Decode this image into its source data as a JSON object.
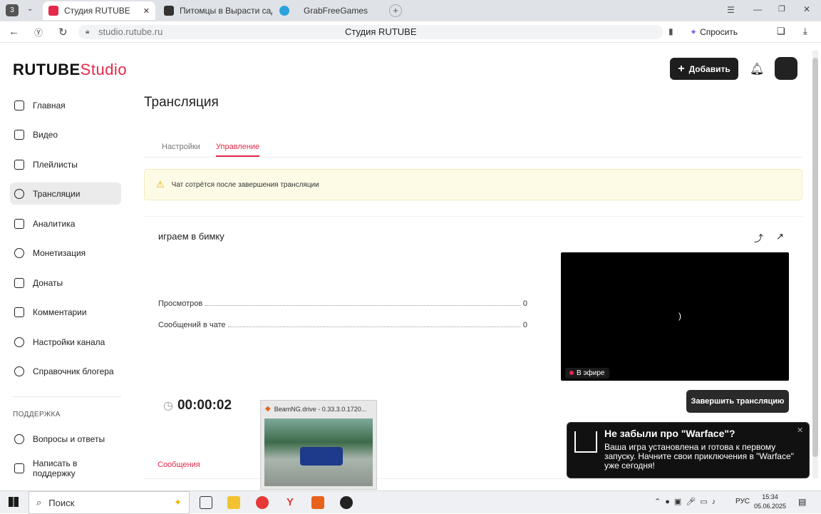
{
  "browser": {
    "tab_count": "3",
    "tabs": [
      {
        "label": "Студия RUTUBE"
      },
      {
        "label": "Питомцы в Вырасти сад!"
      },
      {
        "label": "GrabFreeGames"
      }
    ],
    "url": "studio.rutube.ru",
    "page_title": "Студия RUTUBE",
    "ask_label": "Спросить"
  },
  "header": {
    "logo_main": "RUTUBE",
    "logo_studio": "Studio",
    "add_label": "Добавить"
  },
  "sidebar": {
    "items": [
      {
        "label": "Главная"
      },
      {
        "label": "Видео"
      },
      {
        "label": "Плейлисты"
      },
      {
        "label": "Трансляции"
      },
      {
        "label": "Аналитика"
      },
      {
        "label": "Монетизация"
      },
      {
        "label": "Донаты"
      },
      {
        "label": "Комментарии"
      },
      {
        "label": "Настройки канала"
      },
      {
        "label": "Справочник блогера"
      }
    ],
    "support_heading": "ПОДДЕРЖКА",
    "support_items": [
      {
        "label": "Вопросы и ответы"
      },
      {
        "label": "Написать в поддержку"
      }
    ]
  },
  "main": {
    "title": "Трансляция",
    "tabs": [
      {
        "label": "Настройки"
      },
      {
        "label": "Управление"
      }
    ],
    "warning": "Чат сотрётся после завершения трансляции",
    "stream_title": "играем в бимку",
    "stats": [
      {
        "label": "Просмотров",
        "value": "0"
      },
      {
        "label": "Сообщений в чате",
        "value": "0"
      }
    ],
    "live_label": "В эфире",
    "spinner": ")",
    "timer": "00:00:02",
    "end_label": "Завершить трансляцию",
    "messages_tab": "Сообщения"
  },
  "preview": {
    "title": "BeamNG.drive - 0.33.3.0.1720..."
  },
  "toast": {
    "title": "Не забыли про \"Warface\"?",
    "body": "Ваша игра установлена и готова к первому запуску. Начните свои приключения в \"Warface\" уже сегодня!"
  },
  "taskbar": {
    "search": "Поиск",
    "lang": "РУС",
    "time": "15:34",
    "date": "05.06.2025"
  },
  "colors": {
    "accent": "#e5294b",
    "dark_button": "#1e1e1e"
  }
}
